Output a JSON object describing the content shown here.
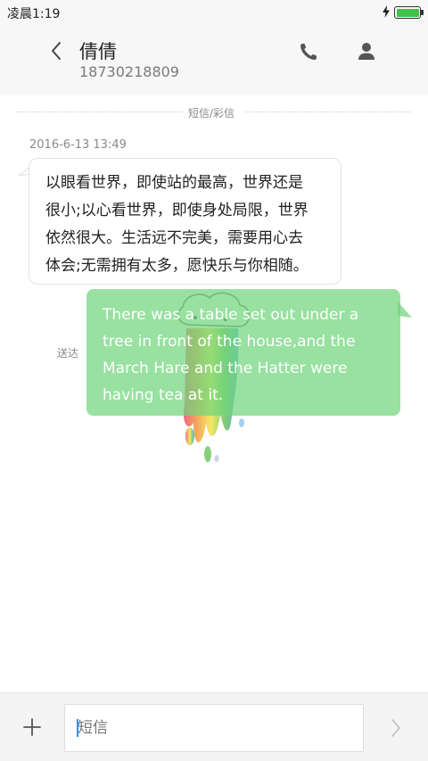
{
  "status_bar": {
    "time": "凌晨1:19",
    "battery_level": 1.0,
    "battery_color": "#3ec24a",
    "charging_icon": "lightning-icon"
  },
  "header": {
    "contact_name": "倩倩",
    "phone_number": "18730218809",
    "back_icon": "chevron-left-icon",
    "call_icon": "phone-icon",
    "contact_icon": "person-icon"
  },
  "conversation": {
    "divider_label": "短信/彩信",
    "messages": [
      {
        "direction": "incoming",
        "timestamp": "2016-6-13 13:49",
        "lines": [
          "以眼看世界，即使站的最高，世界还是",
          "很小;以心看世界，即使身处局限，世界",
          "依然很大。生活远不完美，需要用心去",
          "体会;无需拥有太多，愿快乐与你相随。"
        ]
      },
      {
        "direction": "outgoing",
        "status": "送达",
        "lines": [
          "There was a table set out under a",
          "tree in front of the house,and the",
          "March Hare and the Hatter were",
          "having tea at it."
        ],
        "bubble_color": "#70d57c"
      }
    ]
  },
  "input_bar": {
    "placeholder": "短信",
    "add_icon": "plus-icon",
    "send_icon": "chevron-right-icon"
  }
}
